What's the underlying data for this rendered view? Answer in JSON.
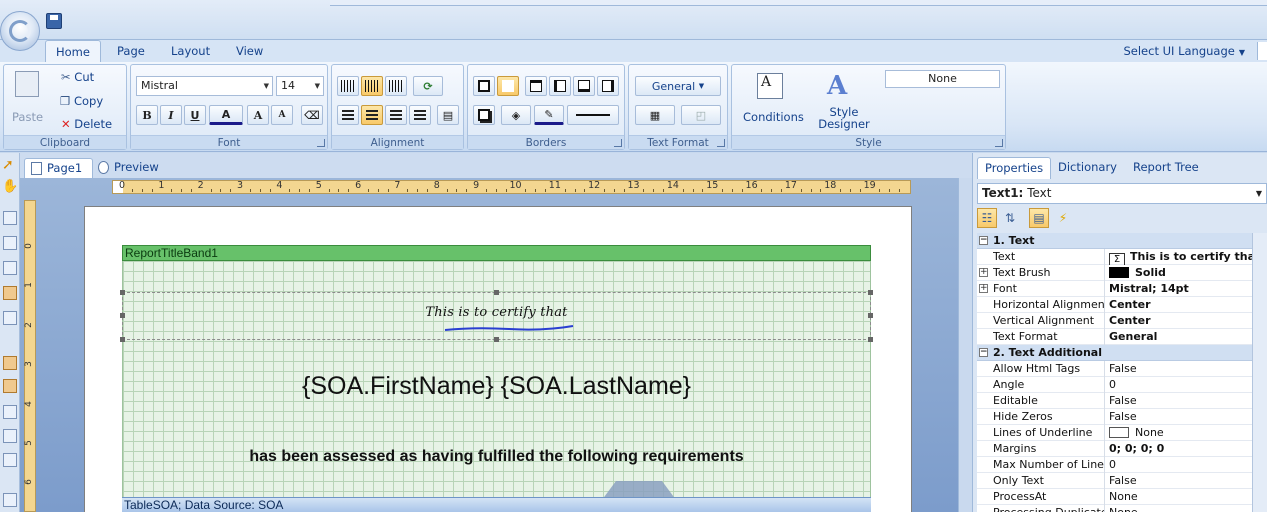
{
  "ribbon": {
    "tabs": [
      "Home",
      "Page",
      "Layout",
      "View"
    ],
    "active_tab": "Home",
    "language_label": "Select UI Language",
    "clipboard": {
      "paste": "Paste",
      "cut": "Cut",
      "copy": "Copy",
      "delete": "Delete",
      "label": "Clipboard"
    },
    "font": {
      "family": "Mistral",
      "size": "14",
      "bold": "B",
      "italic": "I",
      "underline": "U",
      "color": "A",
      "grow": "A",
      "shrink": "A",
      "label": "Font"
    },
    "alignment": {
      "label": "Alignment"
    },
    "borders": {
      "label": "Borders"
    },
    "text_format": {
      "value": "General",
      "label": "Text Format"
    },
    "style": {
      "conditions": "Conditions",
      "style_designer": "Style Designer",
      "style_value": "None",
      "label": "Style"
    }
  },
  "document_tabs": [
    "Page1",
    "Preview"
  ],
  "ruler": {
    "h_ticks": [
      "0",
      "1",
      "2",
      "3",
      "4",
      "5",
      "6",
      "7",
      "8",
      "9",
      "10",
      "11",
      "12",
      "13",
      "14",
      "15",
      "16",
      "17",
      "18",
      "19"
    ],
    "v_ticks": [
      "0",
      "1",
      "2",
      "3",
      "4",
      "5",
      "6"
    ]
  },
  "report": {
    "title_band": "ReportTitleBand1",
    "certify_text": "This is to certify that",
    "name_field": "{SOA.FirstName} {SOA.LastName}",
    "assessed_text": "has been assessed as having fulfilled the following requirements",
    "table_band": "TableSOA; Data Source: SOA"
  },
  "properties_panel": {
    "tabs": [
      "Properties",
      "Dictionary",
      "Report Tree"
    ],
    "selected_object_name": "Text1:",
    "selected_object_type": "Text",
    "categories": [
      {
        "title": "1. Text",
        "rows": [
          {
            "name": "Text",
            "value": "This is to certify that",
            "bold": true,
            "expand": false,
            "marker": "sigma"
          },
          {
            "name": "Text Brush",
            "value": "Solid",
            "bold": true,
            "expand": true,
            "marker": "swatch-black"
          },
          {
            "name": "Font",
            "value": "Mistral; 14pt",
            "bold": true,
            "expand": true
          },
          {
            "name": "Horizontal Alignment",
            "value": "Center",
            "bold": true
          },
          {
            "name": "Vertical Alignment",
            "value": "Center",
            "bold": true
          },
          {
            "name": "Text Format",
            "value": "General",
            "bold": true
          }
        ]
      },
      {
        "title": "2. Text Additional",
        "rows": [
          {
            "name": "Allow Html Tags",
            "value": "False"
          },
          {
            "name": "Angle",
            "value": "0"
          },
          {
            "name": "Editable",
            "value": "False"
          },
          {
            "name": "Hide Zeros",
            "value": "False"
          },
          {
            "name": "Lines of Underline",
            "value": "None",
            "marker": "swatch-white"
          },
          {
            "name": "Margins",
            "value": "0; 0; 0; 0",
            "bold": true
          },
          {
            "name": "Max Number of Lines",
            "value": "0"
          },
          {
            "name": "Only Text",
            "value": "False"
          },
          {
            "name": "ProcessAt",
            "value": "None"
          },
          {
            "name": "Processing Duplicates",
            "value": "None"
          }
        ]
      }
    ]
  }
}
